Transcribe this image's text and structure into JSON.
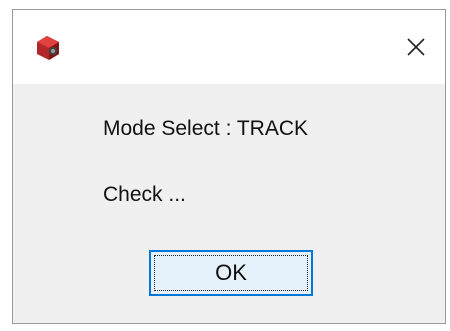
{
  "dialog": {
    "title_icon": "app-icon",
    "close_label": "×",
    "message_line1": "Mode Select : TRACK",
    "message_line2": "Check ...",
    "ok_label": "OK"
  },
  "colors": {
    "title_bar": "#ffffff",
    "content_background": "#f0f0f0",
    "button_border": "#0078d7",
    "button_fill": "#e5f1fb",
    "icon_red": "#c0392b"
  }
}
